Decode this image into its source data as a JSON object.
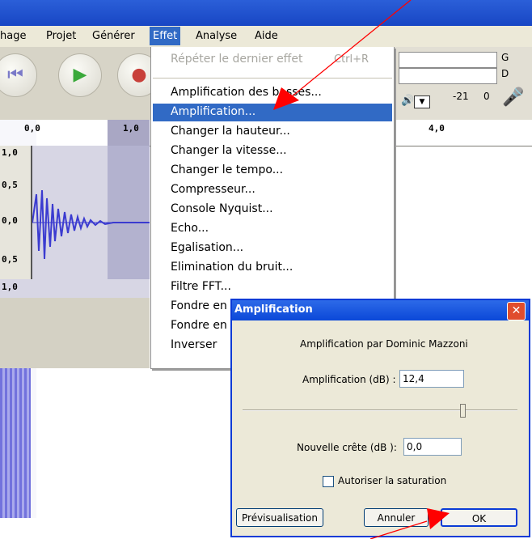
{
  "menubar": {
    "items": [
      "hage",
      "Projet",
      "Générer",
      "Effet",
      "Analyse",
      "Aide"
    ],
    "active": "Effet"
  },
  "ruler": {
    "labels": [
      "0,0",
      "1,0",
      "4,0"
    ]
  },
  "track": {
    "yLabels": [
      "1,0",
      "0,5",
      "0,0",
      "0,5",
      "1,0"
    ]
  },
  "meters": {
    "left_label": "G",
    "right_label": "D",
    "scale": [
      "-21",
      "0"
    ]
  },
  "effect_menu": {
    "repeat_label": "Répéter le dernier effet",
    "repeat_shortcut": "Ctrl+R",
    "items": [
      "Amplification des basses...",
      "Amplification...",
      "Changer la hauteur...",
      "Changer la vitesse...",
      "Changer le tempo...",
      "Compresseur...",
      "Console Nyquist...",
      "Echo...",
      "Egalisation...",
      "Elimination du bruit...",
      "Filtre FFT...",
      "Fondre en",
      "Fondre en",
      "Inverser"
    ],
    "highlighted": "Amplification..."
  },
  "dialog": {
    "title": "Amplification",
    "subtitle": "Amplification par Dominic Mazzoni",
    "amplification_label": "Amplification (dB) :",
    "amplification_value": "12,4",
    "slider_value": 0.8,
    "peak_label": "Nouvelle crête (dB ):",
    "peak_value": "0,0",
    "clipping_label": "Autoriser la saturation",
    "clipping_checked": false,
    "preview_label": "Prévisualisation",
    "cancel_label": "Annuler",
    "ok_label": "OK",
    "close_glyph": "✕"
  },
  "colors": {
    "accent": "#316ac5",
    "annotation": "#ff0000",
    "titlebar": "#1846c4"
  }
}
